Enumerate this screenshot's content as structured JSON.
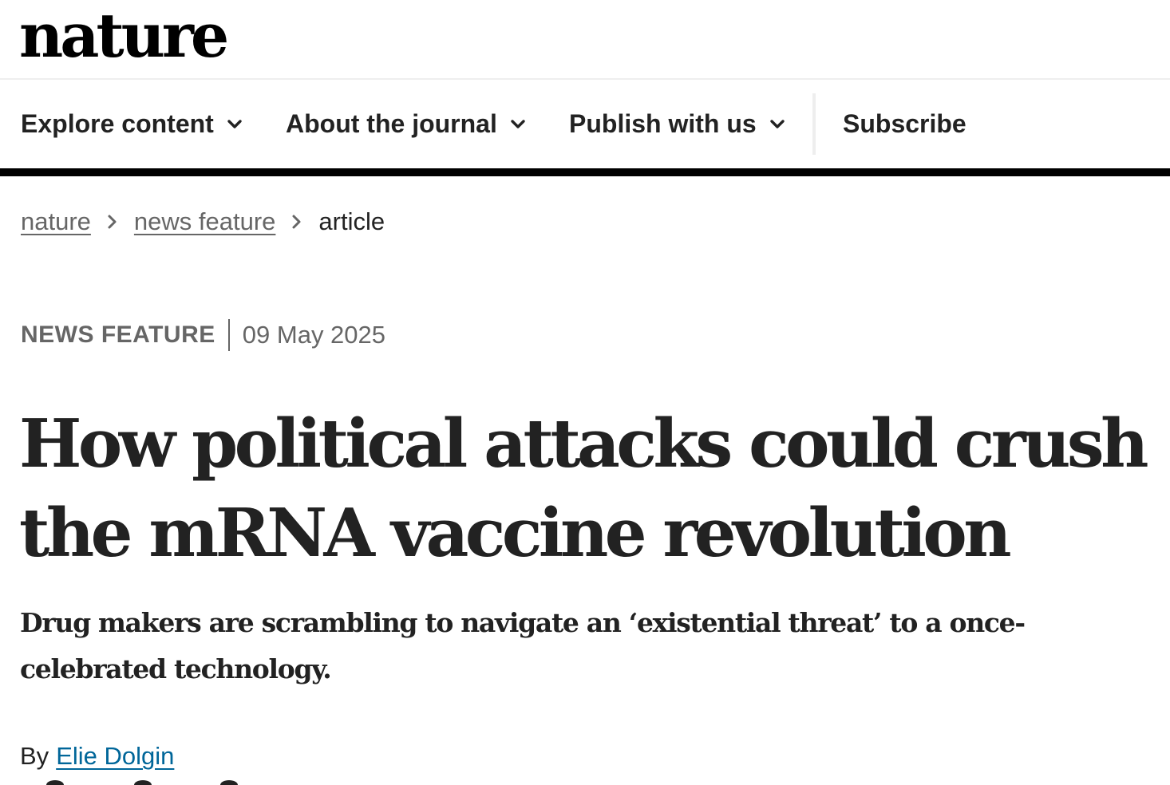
{
  "site": {
    "logo_text": "nature"
  },
  "nav": {
    "items": [
      {
        "label": "Explore content",
        "has_dropdown": true
      },
      {
        "label": "About the journal",
        "has_dropdown": true
      },
      {
        "label": "Publish with us",
        "has_dropdown": true
      }
    ],
    "subscribe_label": "Subscribe"
  },
  "breadcrumb": {
    "items": [
      {
        "label": "nature",
        "link": true
      },
      {
        "label": "news feature",
        "link": true
      },
      {
        "label": "article",
        "link": false
      }
    ]
  },
  "article": {
    "type": "NEWS FEATURE",
    "date": "09 May 2025",
    "title": "How political attacks could crush the mRNA vaccine revolution",
    "standfirst": "Drug makers are scrambling to navigate an ‘existential threat’ to a once-celebrated technology.",
    "byline_prefix": "By",
    "author": "Elie Dolgin"
  },
  "colors": {
    "text": "#222222",
    "muted": "#666666",
    "link": "#006699",
    "nav_rule": "#000000",
    "divider": "#eeeeee"
  }
}
